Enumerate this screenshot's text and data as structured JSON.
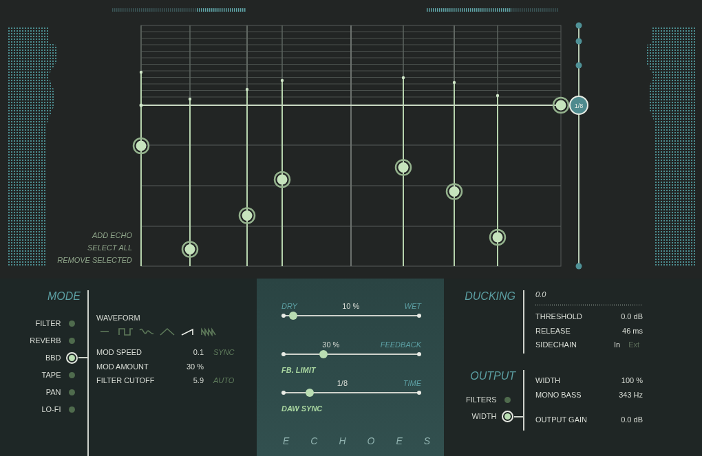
{
  "echo_actions": [
    "ADD ECHO",
    "SELECT ALL",
    "REMOVE SELECTED"
  ],
  "echoes": [
    {
      "level": 0.5
    },
    {
      "level": 0.07
    },
    {
      "level": 0.21
    },
    {
      "level": 0.36
    },
    {
      "level": 0.41
    },
    {
      "level": 0.31
    },
    {
      "level": 0.12
    }
  ],
  "time_knob": {
    "label": "1/8"
  },
  "mode": {
    "title": "MODE",
    "items": [
      {
        "label": "FILTER",
        "selected": false
      },
      {
        "label": "REVERB",
        "selected": false
      },
      {
        "label": "BBD",
        "selected": true
      },
      {
        "label": "TAPE",
        "selected": false
      },
      {
        "label": "PAN",
        "selected": false
      },
      {
        "label": "LO-FI",
        "selected": false
      }
    ]
  },
  "waveform": {
    "label": "WAVEFORM",
    "shapes": [
      {
        "kind": "flat",
        "selected": false
      },
      {
        "kind": "square",
        "selected": false
      },
      {
        "kind": "sine",
        "selected": false
      },
      {
        "kind": "triangle",
        "selected": false
      },
      {
        "kind": "saw",
        "selected": true
      },
      {
        "kind": "random",
        "selected": false
      }
    ]
  },
  "mode_params": [
    {
      "name": "MOD SPEED",
      "value": "0.1",
      "tag": "SYNC"
    },
    {
      "name": "MOD AMOUNT",
      "value": "30 %"
    },
    {
      "name": "FILTER CUTOFF",
      "value": "5.9",
      "tag": "AUTO"
    }
  ],
  "mix": {
    "sliders": [
      {
        "label_left": "DRY",
        "value": "10 %",
        "label_right": "WET",
        "level": 0.085
      },
      {
        "value": "30 %",
        "label_right": "FEEDBACK",
        "label_below": "FB. LIMIT",
        "level": 0.3
      },
      {
        "value": "1/8",
        "label_right": "TIME",
        "label_below": "DAW SYNC",
        "level": 0.2
      }
    ],
    "product_name": "ECHOES"
  },
  "ducking": {
    "title": "DUCKING",
    "meter_reading": "0.0",
    "params": [
      {
        "name": "THRESHOLD",
        "value": "0.0 dB"
      },
      {
        "name": "RELEASE",
        "value": "46 ms"
      },
      {
        "name": "SIDECHAIN",
        "options": [
          {
            "label": "In",
            "selected": true
          },
          {
            "label": "Ext",
            "selected": false
          }
        ]
      }
    ]
  },
  "output": {
    "title": "OUTPUT",
    "toggles": [
      {
        "label": "FILTERS",
        "selected": false
      },
      {
        "label": "WIDTH",
        "selected": true
      }
    ],
    "params": [
      {
        "name": "WIDTH",
        "value": "100 %"
      },
      {
        "name": "MONO BASS",
        "value": "343 Hz"
      },
      {
        "name": "OUTPUT GAIN",
        "value": "0.0 dB"
      }
    ]
  }
}
